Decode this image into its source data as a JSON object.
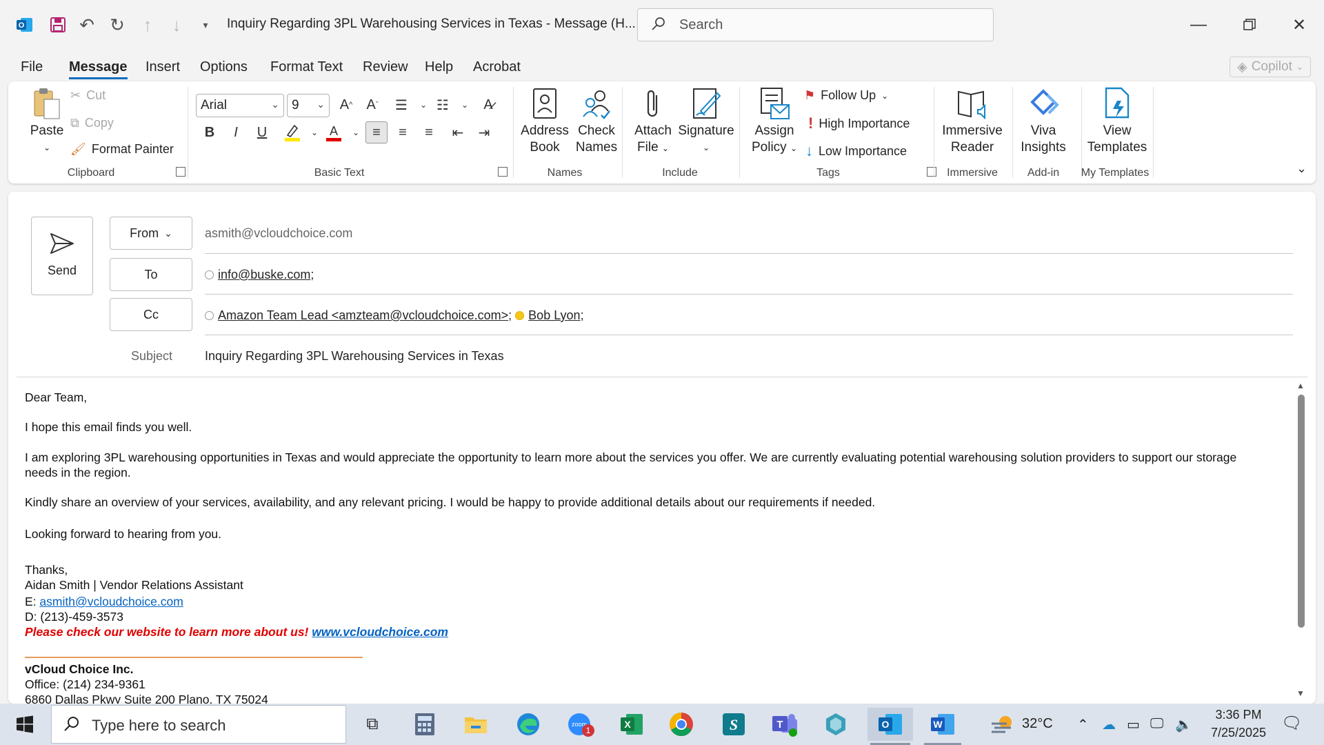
{
  "titlebar": {
    "title": "Inquiry Regarding 3PL Warehousing Services in Texas  -  Message (H...",
    "search_placeholder": "Search"
  },
  "menu": {
    "tabs": [
      "File",
      "Message",
      "Insert",
      "Options",
      "Format Text",
      "Review",
      "Help",
      "Acrobat"
    ],
    "copilot": "Copilot"
  },
  "ribbon": {
    "clipboard": {
      "paste": "Paste",
      "cut": "Cut",
      "copy": "Copy",
      "format_painter": "Format Painter",
      "label": "Clipboard"
    },
    "basic_text": {
      "font": "Arial",
      "size": "9",
      "label": "Basic Text"
    },
    "names": {
      "address_book_1": "Address",
      "address_book_2": "Book",
      "check_names_1": "Check",
      "check_names_2": "Names",
      "label": "Names"
    },
    "include": {
      "attach_1": "Attach",
      "attach_2": "File",
      "signature": "Signature",
      "label": "Include"
    },
    "tags": {
      "assign_1": "Assign",
      "assign_2": "Policy",
      "follow_up": "Follow Up",
      "high": "High Importance",
      "low": "Low Importance",
      "label": "Tags"
    },
    "immersive": {
      "btn_1": "Immersive",
      "btn_2": "Reader",
      "label": "Immersive"
    },
    "addin": {
      "btn_1": "Viva",
      "btn_2": "Insights",
      "label": "Add-in"
    },
    "templates": {
      "btn_1": "View",
      "btn_2": "Templates",
      "label": "My Templates"
    }
  },
  "compose": {
    "send": "Send",
    "from_label": "From",
    "from_value": "asmith@vcloudchoice.com",
    "to_label": "To",
    "to_value": "info@buske.com",
    "cc_label": "Cc",
    "cc_1": "Amazon Team Lead <amzteam@vcloudchoice.com>",
    "cc_2": "Bob Lyon",
    "subject_label": "Subject",
    "subject_value": "Inquiry Regarding 3PL Warehousing Services in Texas"
  },
  "body": {
    "greeting": "Dear Team,",
    "line1": "I hope this email finds you well.",
    "para2a": "I am exploring 3PL warehousing opportunities in Texas and would appreciate the opportunity to learn more about the services you offer. We are currently evaluating potential warehousing solution providers to support our storage",
    "para2b": "needs in the region.",
    "para3": "Kindly share an overview of your services, availability, and any relevant pricing. I would be happy to provide additional details about our requirements if needed.",
    "para4": "Looking forward to hearing from you.",
    "thanks": "Thanks,",
    "sig_name": "Aidan Smith | Vendor Relations Assistant",
    "sig_email_label": "E: ",
    "sig_email": "asmith@vcloudchoice.com",
    "sig_phone": "D: (213)-459-3573",
    "promo_text": "Please check our website to learn more about us! ",
    "promo_link": "www.vcloudchoice.com",
    "company": "vCloud Choice Inc.",
    "office": "Office: (214) 234-9361",
    "address": "6860 Dallas Pkwy Suite 200 Plano, TX 75024"
  },
  "taskbar": {
    "search_placeholder": "Type here to search",
    "weather": "32°C",
    "time": "3:36 PM",
    "date": "7/25/2025",
    "zoom_badge": "1"
  }
}
